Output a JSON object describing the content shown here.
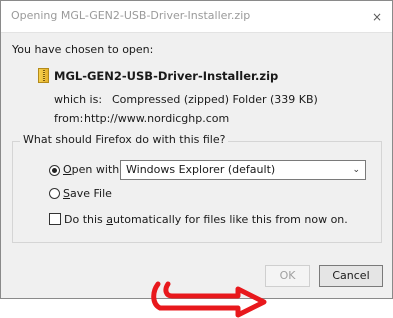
{
  "window": {
    "title": "Opening MGL-GEN2-USB-Driver-Installer.zip",
    "close_glyph": "×"
  },
  "heading": "You have chosen to open:",
  "file": {
    "icon": "zip-archive-icon",
    "name": "MGL-GEN2-USB-Driver-Installer.zip",
    "which_is_label": "which is:",
    "which_is_value": "Compressed (zipped) Folder (339 KB)",
    "from_label": "from:",
    "from_value": "http://www.nordicghp.com"
  },
  "action_group": {
    "legend": "What should Firefox do with this file?",
    "open_with": {
      "access_key": "O",
      "label_rest": "pen with",
      "selected": true,
      "app": "Windows Explorer (default)"
    },
    "save_file": {
      "access_key": "S",
      "label_rest": "ave File",
      "selected": false
    },
    "auto": {
      "label_before": "Do this ",
      "access_key": "a",
      "label_after": "utomatically for files like this from now on.",
      "checked": false
    }
  },
  "buttons": {
    "ok": "OK",
    "cancel": "Cancel"
  },
  "annotation": {
    "color": "#e8181c"
  }
}
